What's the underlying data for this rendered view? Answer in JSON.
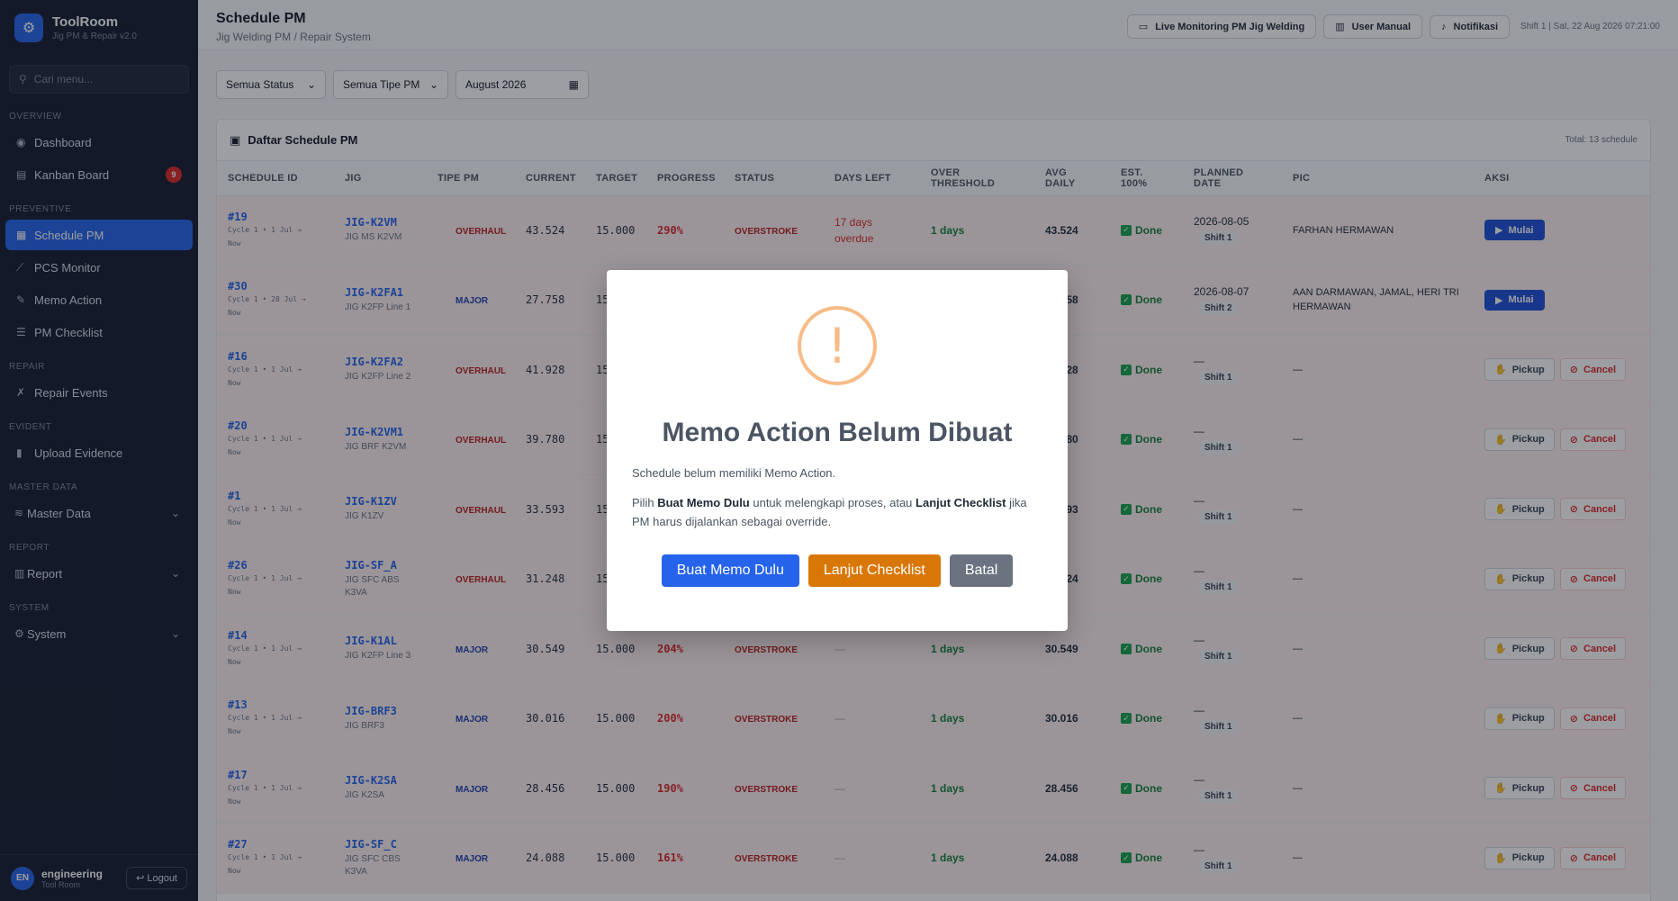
{
  "brand": {
    "title": "ToolRoom",
    "subtitle": "Jig PM & Repair v2.0"
  },
  "search": {
    "placeholder": "Cari menu..."
  },
  "sidebar": {
    "sections": [
      {
        "label": "OVERVIEW"
      },
      {
        "label": "PREVENTIVE"
      },
      {
        "label": "REPAIR"
      },
      {
        "label": "EVIDENT"
      },
      {
        "label": "MASTER DATA"
      },
      {
        "label": "REPORT"
      },
      {
        "label": "SYSTEM"
      }
    ],
    "items": [
      {
        "label": "Dashboard"
      },
      {
        "label": "Kanban Board",
        "badge": "9"
      },
      {
        "label": "Schedule PM"
      },
      {
        "label": "PCS Monitor"
      },
      {
        "label": "Memo Action"
      },
      {
        "label": "PM Checklist"
      },
      {
        "label": "Repair Events"
      },
      {
        "label": "Upload Evidence"
      },
      {
        "label": "Master Data"
      },
      {
        "label": "Report"
      },
      {
        "label": "System"
      }
    ]
  },
  "user": {
    "initials": "EN",
    "name": "engineering",
    "role": "Tool Room",
    "logout": "Logout"
  },
  "header": {
    "title": "Schedule PM",
    "subtitle": "Jig Welding PM / Repair System",
    "btn_live": "Live Monitoring PM Jig Welding",
    "btn_manual": "User Manual",
    "btn_notif": "Notifikasi",
    "shift_info": "Shift 1 | Sat, 22 Aug 2026 07:21:00"
  },
  "filters": {
    "status": "Semua Status",
    "tipe": "Semua Tipe PM",
    "month": "August 2026"
  },
  "panel": {
    "title": "Daftar Schedule PM",
    "total": "Total: 13 schedule"
  },
  "table": {
    "headers": [
      "SCHEDULE ID",
      "JIG",
      "TIPE PM",
      "CURRENT",
      "TARGET",
      "PROGRESS",
      "STATUS",
      "DAYS LEFT",
      "OVER THRESHOLD",
      "AVG DAILY",
      "EST. 100%",
      "PLANNED DATE",
      "PIC",
      "AKSI"
    ],
    "rows": [
      {
        "id": "#19",
        "cycle": "Cycle 1 • 1 Jul →",
        "cycle2": "Now",
        "jig": "JIG-K2VM",
        "jig_name": "JIG MS K2VM",
        "tipe": "OVERHAUL",
        "current": "43.524",
        "target": "15.000",
        "progress": "290%",
        "status": "OVERSTROKE",
        "days_left": "17 days overdue",
        "threshold": "1 days",
        "avg": "43.524",
        "est": "Done",
        "planned": "2026-08-05",
        "shift": "Shift 1",
        "pic": "FARHAN HERMAWAN",
        "action": "mulai"
      },
      {
        "id": "#30",
        "cycle": "Cycle 1 • 28 Jul →",
        "cycle2": "Now",
        "jig": "JIG-K2FA1",
        "jig_name": "JIG K2FP Line 1",
        "tipe": "MAJOR",
        "current": "27.758",
        "target": "15.000",
        "progress": "",
        "status": "",
        "days_left": "",
        "threshold": "",
        "avg": "27.758",
        "est": "Done",
        "planned": "2026-08-07",
        "shift": "Shift 2",
        "pic": "AAN DARMAWAN, JAMAL, HERI TRI HERMAWAN",
        "action": "mulai"
      },
      {
        "id": "#16",
        "cycle": "Cycle 1 • 1 Jul →",
        "cycle2": "Now",
        "jig": "JIG-K2FA2",
        "jig_name": "JIG K2FP Line 2",
        "tipe": "OVERHAUL",
        "current": "41.928",
        "target": "15.000",
        "progress": "",
        "status": "",
        "days_left": "",
        "threshold": "",
        "avg": "41.928",
        "est": "Done",
        "planned": "—",
        "shift": "Shift 1",
        "pic": "—",
        "action": "pickup"
      },
      {
        "id": "#20",
        "cycle": "Cycle 1 • 1 Jul →",
        "cycle2": "Now",
        "jig": "JIG-K2VM1",
        "jig_name": "JIG BRF K2VM",
        "tipe": "OVERHAUL",
        "current": "39.780",
        "target": "15.000",
        "progress": "",
        "status": "",
        "days_left": "",
        "threshold": "",
        "avg": "39.780",
        "est": "Done",
        "planned": "—",
        "shift": "Shift 1",
        "pic": "—",
        "action": "pickup"
      },
      {
        "id": "#1",
        "cycle": "Cycle 1 • 1 Jul →",
        "cycle2": "Now",
        "jig": "JIG-K1ZV",
        "jig_name": "JIG K1ZV",
        "tipe": "OVERHAUL",
        "current": "33.593",
        "target": "15.000",
        "progress": "",
        "status": "",
        "days_left": "",
        "threshold": "",
        "avg": "33.593",
        "est": "Done",
        "planned": "—",
        "shift": "Shift 1",
        "pic": "—",
        "action": "pickup"
      },
      {
        "id": "#26",
        "cycle": "Cycle 1 • 1 Jul →",
        "cycle2": "Now",
        "jig": "JIG-SF_A",
        "jig_name": "JIG SFC ABS K3VA",
        "tipe": "OVERHAUL",
        "current": "31.248",
        "target": "15.000",
        "progress": "",
        "status": "",
        "days_left": "",
        "threshold": "",
        "avg": "31.224",
        "est": "Done",
        "planned": "—",
        "shift": "Shift 1",
        "pic": "—",
        "action": "pickup"
      },
      {
        "id": "#14",
        "cycle": "Cycle 1 • 1 Jul →",
        "cycle2": "Now",
        "jig": "JIG-K1AL",
        "jig_name": "JIG K2FP Line 3",
        "tipe": "MAJOR",
        "current": "30.549",
        "target": "15.000",
        "progress": "204%",
        "status": "OVERSTROKE",
        "days_left": "—",
        "threshold": "1 days",
        "avg": "30.549",
        "est": "Done",
        "planned": "—",
        "shift": "Shift 1",
        "pic": "—",
        "action": "pickup"
      },
      {
        "id": "#13",
        "cycle": "Cycle 1 • 1 Jul →",
        "cycle2": "Now",
        "jig": "JIG-BRF3",
        "jig_name": "JIG BRF3",
        "tipe": "MAJOR",
        "current": "30.016",
        "target": "15.000",
        "progress": "200%",
        "status": "OVERSTROKE",
        "days_left": "—",
        "threshold": "1 days",
        "avg": "30.016",
        "est": "Done",
        "planned": "—",
        "shift": "Shift 1",
        "pic": "—",
        "action": "pickup"
      },
      {
        "id": "#17",
        "cycle": "Cycle 1 • 1 Jul →",
        "cycle2": "Now",
        "jig": "JIG-K2SA",
        "jig_name": "JIG K2SA",
        "tipe": "MAJOR",
        "current": "28.456",
        "target": "15.000",
        "progress": "190%",
        "status": "OVERSTROKE",
        "days_left": "—",
        "threshold": "1 days",
        "avg": "28.456",
        "est": "Done",
        "planned": "—",
        "shift": "Shift 1",
        "pic": "—",
        "action": "pickup"
      },
      {
        "id": "#27",
        "cycle": "Cycle 1 • 1 Jul →",
        "cycle2": "Now",
        "jig": "JIG-SF_C",
        "jig_name": "JIG SFC CBS K3VA",
        "tipe": "MAJOR",
        "current": "24.088",
        "target": "15.000",
        "progress": "161%",
        "status": "OVERSTROKE",
        "days_left": "—",
        "threshold": "1 days",
        "avg": "24.088",
        "est": "Done",
        "planned": "—",
        "shift": "Shift 1",
        "pic": "—",
        "action": "pickup"
      }
    ],
    "btn_mulai": "Mulai",
    "btn_pickup": "Pickup",
    "btn_cancel": "Cancel"
  },
  "colors": {
    "overhaul": "#b91c1c",
    "major": "#1e40af",
    "accent": "#2563eb"
  },
  "modal": {
    "title": "Memo Action Belum Dibuat",
    "line1": "Schedule belum memiliki Memo Action.",
    "line2_pre": "Pilih ",
    "line2_b1": "Buat Memo Dulu",
    "line2_mid": " untuk melengkapi proses, atau ",
    "line2_b2": "Lanjut Checklist",
    "line2_post": " jika PM harus dijalankan sebagai override.",
    "btn_primary": "Buat Memo Dulu",
    "btn_secondary": "Lanjut Checklist",
    "btn_cancel": "Batal"
  }
}
